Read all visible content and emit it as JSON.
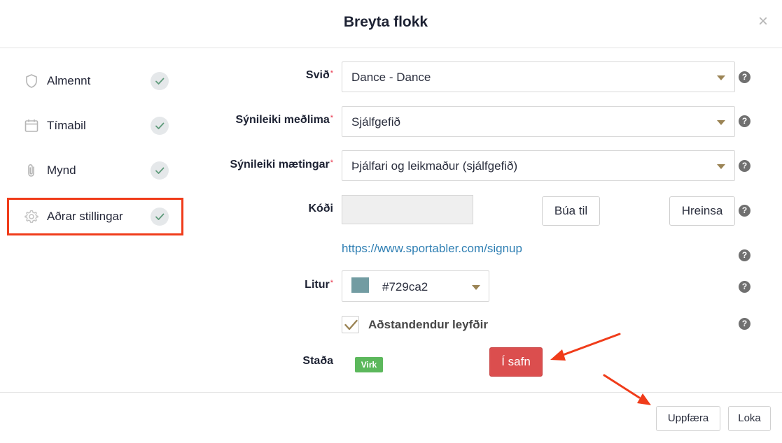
{
  "modal": {
    "title": "Breyta flokk",
    "close": "×"
  },
  "sidebar": {
    "items": [
      {
        "label": "Almennt",
        "icon": "shield-icon",
        "completed": true,
        "active": false
      },
      {
        "label": "Tímabil",
        "icon": "calendar-icon",
        "completed": true,
        "active": false
      },
      {
        "label": "Mynd",
        "icon": "paperclip-icon",
        "completed": true,
        "active": false
      },
      {
        "label": "Aðrar stillingar",
        "icon": "gear-icon",
        "completed": true,
        "active": true
      }
    ]
  },
  "form": {
    "svid": {
      "label": "Svið",
      "value": "Dance - Dance"
    },
    "synileiki_medlima": {
      "label": "Sýnileiki meðlima",
      "value": "Sjálfgefið"
    },
    "synileiki_maetingar": {
      "label": "Sýnileiki mætingar",
      "value": "Þjálfari og leikmaður (sjálfgefið)"
    },
    "kodi": {
      "label": "Kóði",
      "value": "",
      "generate_label": "Búa til",
      "clear_label": "Hreinsa"
    },
    "signup_link": "https://www.sportabler.com/signup",
    "litur": {
      "label": "Litur",
      "value": "#729ca2"
    },
    "adstandendur": {
      "label": "Aðstandendur leyfðir",
      "checked": true
    },
    "stada": {
      "label": "Staða",
      "badge": "Virk",
      "archive_label": "Í safn"
    },
    "required_marker": "*",
    "help_glyph": "?"
  },
  "footer": {
    "update_label": "Uppfæra",
    "close_label": "Loka"
  },
  "colors": {
    "accent_gold": "#9b8455",
    "link": "#2f7fb3",
    "danger": "#db4e4e",
    "success": "#5cb85c",
    "annotation": "#f03c1a"
  }
}
